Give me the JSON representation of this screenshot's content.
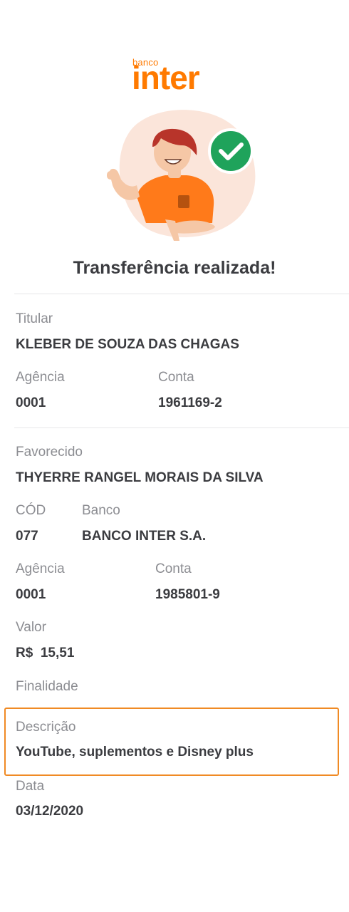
{
  "logo": {
    "small": "banco",
    "big": "inter"
  },
  "colors": {
    "brand_orange": "#ff7a00",
    "success_green": "#1fa35b",
    "highlight_border": "#f08a24"
  },
  "icons": {
    "success": "check-circle-icon"
  },
  "title": "Transferência realizada!",
  "payer": {
    "holder_label": "Titular",
    "holder_value": "KLEBER DE SOUZA DAS CHAGAS",
    "agency_label": "Agência",
    "agency_value": "0001",
    "account_label": "Conta",
    "account_value": "1961169-2"
  },
  "payee": {
    "name_label": "Favorecido",
    "name_value": "THYERRE RANGEL MORAIS DA SILVA",
    "cod_label": "CÓD",
    "cod_value": "077",
    "bank_label": "Banco",
    "bank_value": "BANCO INTER S.A.",
    "agency_label": "Agência",
    "agency_value": "0001",
    "account_label": "Conta",
    "account_value": "1985801-9"
  },
  "transaction": {
    "amount_label": "Valor",
    "amount_value": "R$  15,51",
    "purpose_label": "Finalidade",
    "description_label": "Descrição",
    "description_value": "YouTube, suplementos e Disney plus",
    "date_label": "Data",
    "date_value": "03/12/2020"
  }
}
